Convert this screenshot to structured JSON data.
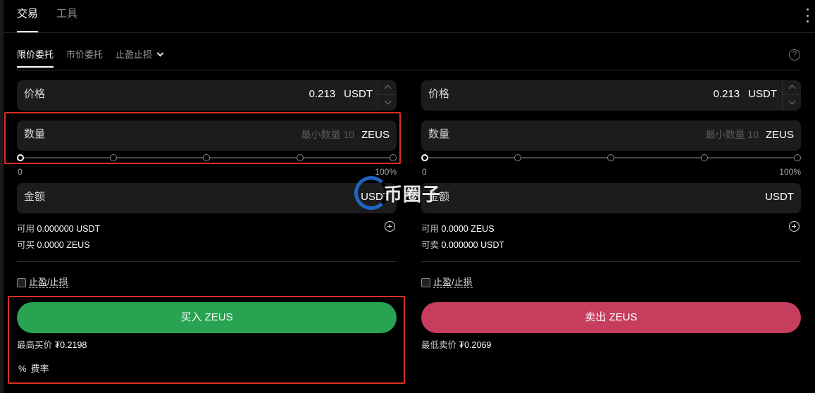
{
  "top_tabs": [
    "交易",
    "工具"
  ],
  "order_tabs": [
    "限价委托",
    "市价委托",
    "止盈止损"
  ],
  "buy": {
    "price_label": "价格",
    "price_value": "0.213",
    "price_unit": "USDT",
    "qty_label": "数量",
    "qty_placeholder": "最小数量 10",
    "qty_unit": "ZEUS",
    "slider_min": "0",
    "slider_max": "100%",
    "amount_label": "金额",
    "amount_unit": "USDT",
    "avail_label": "可用",
    "avail_value": "0.000000 USDT",
    "can_label": "可买",
    "can_value": "0.0000 ZEUS",
    "tpsl_label": "止盈/止损",
    "button_label": "买入 ZEUS",
    "best_label": "最高买价",
    "best_value": "₮0.2198",
    "fee_icon": "%",
    "fee_label": "费率"
  },
  "sell": {
    "price_label": "价格",
    "price_value": "0.213",
    "price_unit": "USDT",
    "qty_label": "数量",
    "qty_placeholder": "最小数量 10",
    "qty_unit": "ZEUS",
    "slider_min": "0",
    "slider_max": "100%",
    "amount_label": "金额",
    "amount_unit": "USDT",
    "avail_label": "可用",
    "avail_value": "0.0000 ZEUS",
    "can_label": "可卖",
    "can_value": "0.000000 USDT",
    "tpsl_label": "止盈/止损",
    "button_label": "卖出 ZEUS",
    "best_label": "最低卖价",
    "best_value": "₮0.2069"
  },
  "watermark": "币圈子",
  "colors": {
    "buy": "#27a352",
    "sell": "#c63d5e",
    "highlight": "#d93025",
    "watermark_logo": "#1f6fd6"
  },
  "icons": [
    "kebab-menu-icon",
    "chevron-down-icon",
    "help-icon",
    "plus-circle-icon",
    "checkbox-icon",
    "percent-icon"
  ]
}
